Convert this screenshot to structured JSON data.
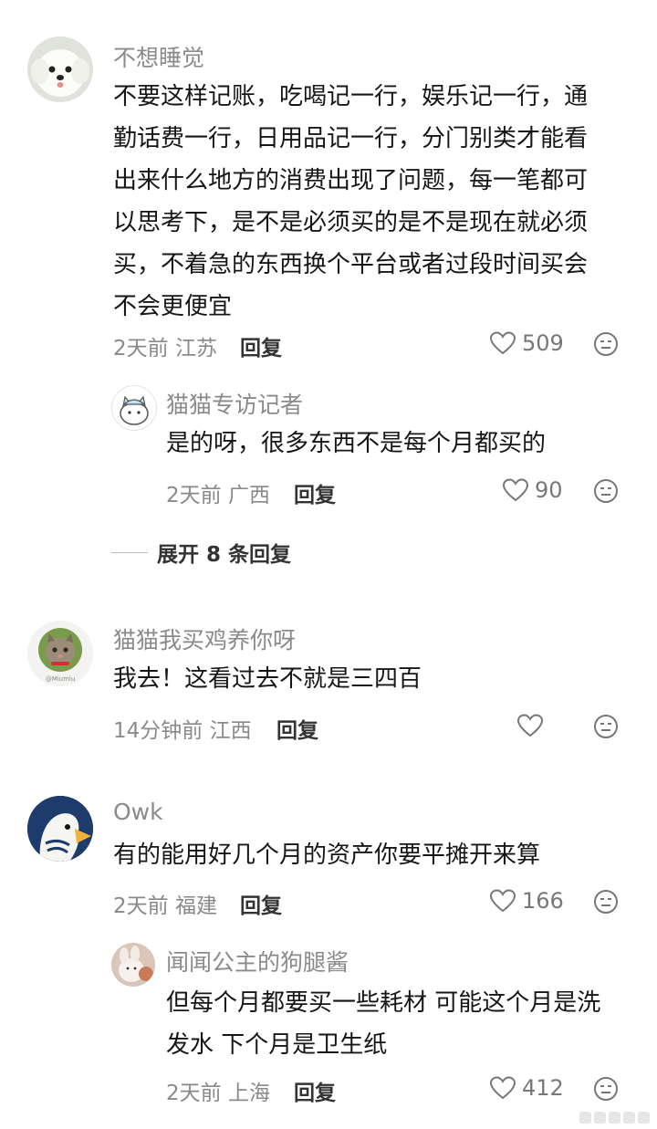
{
  "comments": [
    {
      "username": "不想睡觉",
      "lines": [
        "不要这样记账，吃喝记一行，娱乐记一行，通",
        "勤话费一行，日用品记一行，分门别类才能看",
        "出来什么地方的消费出现了问题，每一笔都可",
        "以思考下，是不是必须买的是不是现在就必须",
        "买，不着急的东西换个平台或者过段时间买会",
        "不会更便宜"
      ],
      "time": "2天前",
      "location": "江苏",
      "reply_label": "回复",
      "likes": "509",
      "avatar_icon": "white-dog-avatar",
      "replies": [
        {
          "username": "猫猫专访记者",
          "text": "是的呀，很多东西不是每个月都买的",
          "time": "2天前",
          "location": "广西",
          "reply_label": "回复",
          "likes": "90",
          "avatar_icon": "cartoon-cat-avatar"
        }
      ],
      "expand_label": "展开 8 条回复"
    },
    {
      "username": "猫猫我买鸡养你呀",
      "text": "我去！这看过去不就是三四百",
      "time": "14分钟前",
      "location": "江西",
      "reply_label": "回复",
      "likes": "",
      "avatar_icon": "tabby-cat-avatar",
      "avatar_caption": "@Miumiu"
    },
    {
      "username": "Owk",
      "text": "有的能用好几个月的资产你要平摊开来算",
      "time": "2天前",
      "location": "福建",
      "reply_label": "回复",
      "likes": "166",
      "avatar_icon": "goose-avatar",
      "replies": [
        {
          "username": "闻闻公主的狗腿酱",
          "lines": [
            "但每个月都要买一些耗材 可能这个月是洗",
            "发水 下个月是卫生纸"
          ],
          "time": "2天前",
          "location": "上海",
          "reply_label": "回复",
          "likes": "412",
          "avatar_icon": "plush-toy-avatar"
        }
      ]
    }
  ],
  "icons": {
    "like": "heart-outline-icon",
    "emoji": "neutral-face-icon"
  },
  "colors": {
    "secondary_text": "#8a8a8a",
    "primary_text": "#161616",
    "icon": "#777777"
  }
}
